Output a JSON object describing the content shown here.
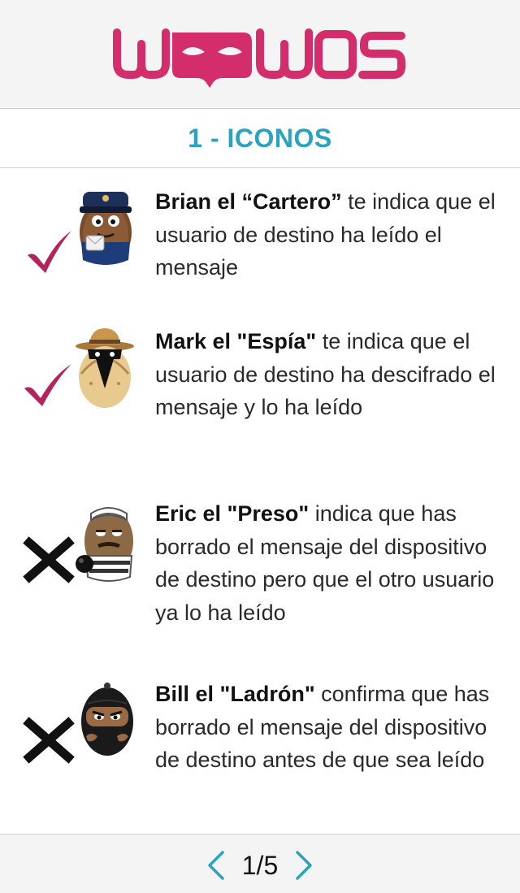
{
  "header": {
    "logo_text": "WOOWOS",
    "brand_color": "#d32d6b"
  },
  "section": {
    "title": "1 - ICONOS",
    "title_color": "#2aa3c1"
  },
  "items": [
    {
      "status_icon": "checkmark-icon",
      "character_icon": "postman-icon",
      "bold": "Brian el “Cartero”",
      "text": " te indica que el usuario de destino ha leído el mensaje"
    },
    {
      "status_icon": "checkmark-icon",
      "character_icon": "spy-icon",
      "bold": "Mark el \"Espía\"",
      "text": " te indica que el usuario de destino ha descifrado el mensaje y lo ha leído"
    },
    {
      "status_icon": "cross-icon",
      "character_icon": "prisoner-icon",
      "bold": "Eric el \"Preso\"",
      "text": " indica que has borrado el mensaje del dispositivo de destino pero que el otro usuario ya lo ha leído"
    },
    {
      "status_icon": "cross-icon",
      "character_icon": "thief-icon",
      "bold": "Bill el \"Ladrón\"",
      "text": " confirma que has borrado el mensaje del dispositivo de destino antes de que sea leído"
    }
  ],
  "pager": {
    "label": "1/5",
    "prev_icon": "chevron-left-icon",
    "next_icon": "chevron-right-icon",
    "accent_color": "#2aa3c1"
  }
}
